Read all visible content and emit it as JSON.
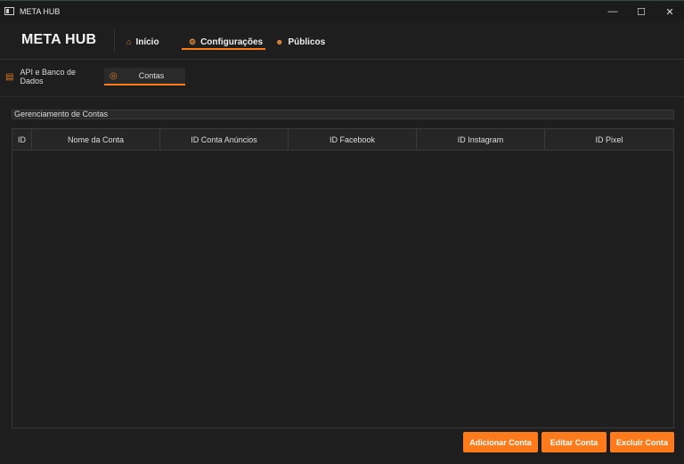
{
  "window": {
    "title": "META HUB",
    "controls": [
      "—",
      "☐",
      "✕"
    ]
  },
  "header": {
    "brand": "META HUB",
    "nav": [
      {
        "label": "Início",
        "icon": "home-icon"
      },
      {
        "label": "Configurações",
        "icon": "gear-icon"
      },
      {
        "label": "Públicos",
        "icon": "users-icon"
      }
    ],
    "active_nav": "Configurações"
  },
  "tabs": [
    {
      "label": "API e Banco de Dados",
      "icon": "database-icon"
    },
    {
      "label": "Contas",
      "icon": "user-circle-icon"
    }
  ],
  "active_tab": "Contas",
  "section": {
    "title": "Gerenciamento de Contas"
  },
  "table": {
    "columns": [
      "ID",
      "Nome da Conta",
      "ID Conta Anúncios",
      "ID Facebook",
      "ID Instagram",
      "ID Pixel"
    ],
    "rows": []
  },
  "actions": {
    "add": "Adicionar Conta",
    "edit": "Editar Conta",
    "delete": "Excluir Conta"
  },
  "colors": {
    "accent": "#ff7a1a",
    "background": "#1e1e1e"
  }
}
